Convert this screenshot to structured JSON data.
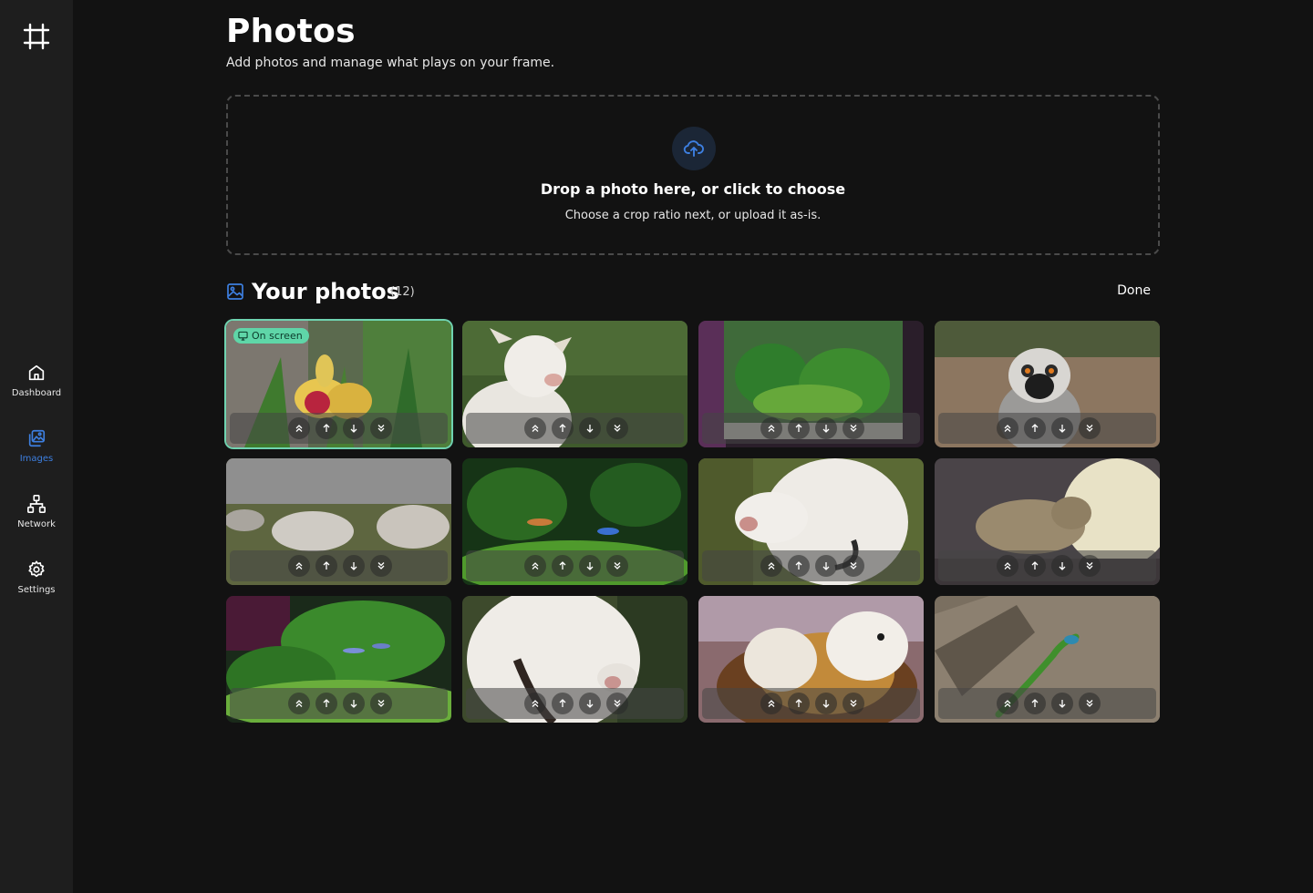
{
  "sidebar": {
    "logo_icon": "frame-hash-icon",
    "items": [
      {
        "label": "Dashboard",
        "icon": "home-icon",
        "active": false
      },
      {
        "label": "Images",
        "icon": "images-icon",
        "active": true
      },
      {
        "label": "Network",
        "icon": "network-icon",
        "active": false
      },
      {
        "label": "Settings",
        "icon": "gear-icon",
        "active": false
      }
    ]
  },
  "header": {
    "title": "Photos",
    "subtitle": "Add photos and manage what plays on your frame."
  },
  "dropzone": {
    "icon": "cloud-upload-icon",
    "title": "Drop a photo here, or click to choose",
    "subtitle": "Choose a crop ratio next, or upload it as-is."
  },
  "photos": {
    "title": "Your photos",
    "count": "(12)",
    "done_label": "Done",
    "on_screen_label": "On screen",
    "items": [
      {
        "subject": "yellow-orchid",
        "on_screen": true
      },
      {
        "subject": "white-dog-on-grass",
        "on_screen": false
      },
      {
        "subject": "planted-aquarium",
        "on_screen": false
      },
      {
        "subject": "ring-tailed-lemur",
        "on_screen": false
      },
      {
        "subject": "cattle-in-field",
        "on_screen": false
      },
      {
        "subject": "aquarium-fish",
        "on_screen": false
      },
      {
        "subject": "white-dog-closeup",
        "on_screen": false
      },
      {
        "subject": "sleeping-tabby-cat",
        "on_screen": false
      },
      {
        "subject": "aquarium-plants-fish",
        "on_screen": false
      },
      {
        "subject": "white-dog-collar",
        "on_screen": false
      },
      {
        "subject": "guinea-pig",
        "on_screen": false
      },
      {
        "subject": "green-lizard-on-log",
        "on_screen": false
      }
    ],
    "controls": [
      "move-to-top-icon",
      "move-up-icon",
      "move-down-icon",
      "move-to-bottom-icon"
    ]
  },
  "colors": {
    "accent": "#3d7fe0",
    "on_screen": "#5fd6a8",
    "background": "#121212",
    "sidebar": "#1e1e1e"
  }
}
